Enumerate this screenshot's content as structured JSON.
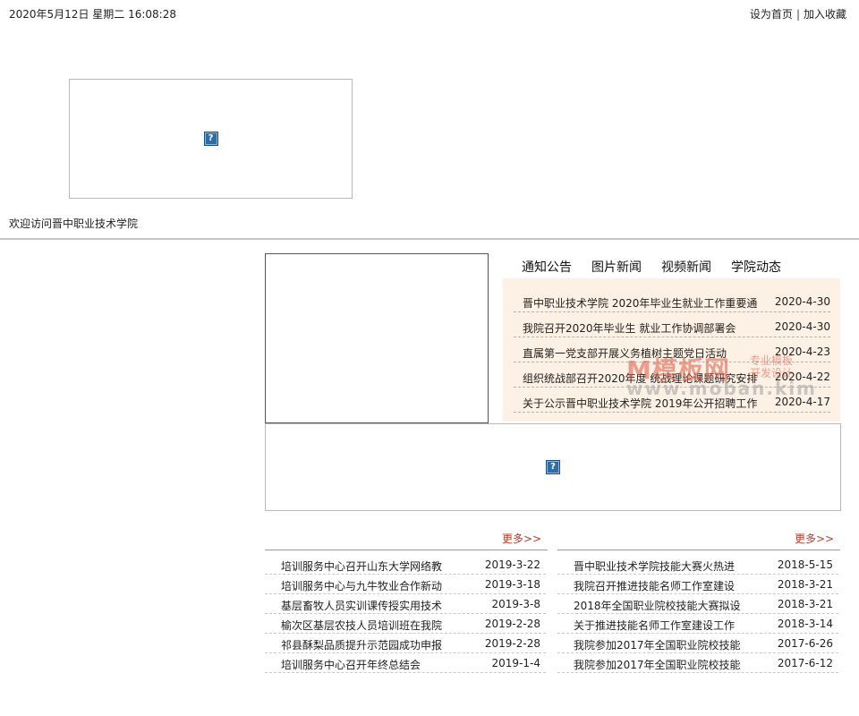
{
  "topbar": {
    "datetime": "2020年5月12日 星期二 16:08:28",
    "set_home": "设为首页",
    "separator": "|",
    "add_favorite": "加入收藏"
  },
  "welcome_text": "欢迎访问晋中职业技术学院",
  "broken_image_glyph": "?",
  "tabs": [
    "通知公告",
    "图片新闻",
    "视频新闻",
    "学院动态"
  ],
  "notices": [
    {
      "title": "晋中职业技术学院 2020年毕业生就业工作重要通",
      "date": "2020-4-30"
    },
    {
      "title": "我院召开2020年毕业生 就业工作协调部署会",
      "date": "2020-4-30"
    },
    {
      "title": "直属第一党支部开展义务植树主题党日活动",
      "date": "2020-4-23"
    },
    {
      "title": "组织统战部召开2020年度 统战理论课题研究安排",
      "date": "2020-4-22"
    },
    {
      "title": "关于公示晋中职业技术学院 2019年公开招聘工作",
      "date": "2020-4-17"
    }
  ],
  "watermark": {
    "main": "M模板网",
    "side": "专业模板 开发设计",
    "url": "www.moban.kim"
  },
  "more_label": "更多>>",
  "left_list": [
    {
      "title": "培训服务中心召开山东大学网络教",
      "date": "2019-3-22"
    },
    {
      "title": "培训服务中心与九牛牧业合作新动",
      "date": "2019-3-18"
    },
    {
      "title": "基层畜牧人员实训课传授实用技术",
      "date": "2019-3-8"
    },
    {
      "title": "榆次区基层农技人员培训班在我院",
      "date": "2019-2-28"
    },
    {
      "title": "祁县酥梨品质提升示范园成功申报",
      "date": "2019-2-28"
    },
    {
      "title": "培训服务中心召开年终总结会",
      "date": "2019-1-4"
    }
  ],
  "right_list": [
    {
      "title": "晋中职业技术学院技能大赛火热进",
      "date": "2018-5-15"
    },
    {
      "title": "我院召开推进技能名师工作室建设",
      "date": "2018-3-21"
    },
    {
      "title": "2018年全国职业院校技能大赛拟设",
      "date": "2018-3-21"
    },
    {
      "title": "关于推进技能名师工作室建设工作",
      "date": "2018-3-14"
    },
    {
      "title": "我院参加2017年全国职业院校技能",
      "date": "2017-6-26"
    },
    {
      "title": "我院参加2017年全国职业院校技能",
      "date": "2017-6-12"
    }
  ]
}
